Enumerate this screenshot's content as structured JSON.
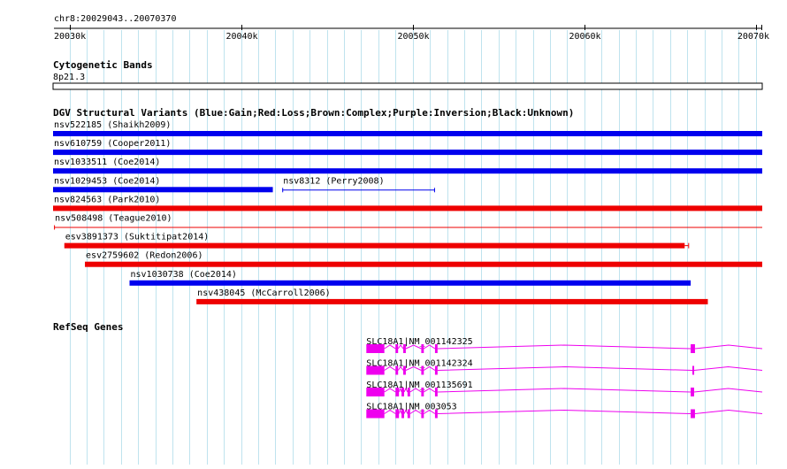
{
  "browser": {
    "location": "chr8:20029043..20070370",
    "view_start": 20029043,
    "view_end": 20070370,
    "ruler_ticks": [
      {
        "pos": 20030000,
        "label": "20030k"
      },
      {
        "pos": 20040000,
        "label": "20040k"
      },
      {
        "pos": 20050000,
        "label": "20050k"
      },
      {
        "pos": 20060000,
        "label": "20060k"
      },
      {
        "pos": 20070000,
        "label": "20070k"
      }
    ],
    "grid_step": 1000
  },
  "tracks": {
    "cytoband": {
      "title": "Cytogenetic Bands",
      "band_label": "8p21.3"
    },
    "dgv": {
      "title": "DGV Structural Variants (Blue:Gain;Red:Loss;Brown:Complex;Purple:Inversion;Black:Unknown)",
      "colors": {
        "gain": "#0000ee",
        "loss": "#ee0000"
      },
      "variants": [
        {
          "label": "nsv522185 (Shaikh2009)",
          "type": "gain",
          "start": 20029043,
          "end": 20070370,
          "row": 0,
          "style": "thick"
        },
        {
          "label": "nsv610759 (Cooper2011)",
          "type": "gain",
          "start": 20029043,
          "end": 20070370,
          "row": 1,
          "style": "thick"
        },
        {
          "label": "nsv1033511 (Coe2014)",
          "type": "gain",
          "start": 20029043,
          "end": 20070370,
          "row": 2,
          "style": "thick"
        },
        {
          "label": "nsv1029453 (Coe2014)",
          "type": "gain",
          "start": 20029043,
          "end": 20041850,
          "row": 3,
          "style": "thick"
        },
        {
          "label": "nsv8312 (Perry2008)",
          "type": "gain",
          "start": 20042400,
          "end": 20051300,
          "row": 3,
          "style": "thin"
        },
        {
          "label": "nsv824563 (Park2010)",
          "type": "loss",
          "start": 20029043,
          "end": 20070370,
          "row": 4,
          "style": "thick"
        },
        {
          "label": "nsv508498 (Teague2010)",
          "type": "loss",
          "start": 20029100,
          "end": 20070370,
          "row": 5,
          "style": "thin"
        },
        {
          "label": "esv3891373 (Suktitipat2014)",
          "type": "loss",
          "start": 20029700,
          "end": 20065850,
          "row": 6,
          "style": "thick_tail"
        },
        {
          "label": "esv2759602 (Redon2006)",
          "type": "loss",
          "start": 20030900,
          "end": 20070370,
          "row": 7,
          "style": "thick"
        },
        {
          "label": "nsv1030738 (Coe2014)",
          "type": "gain",
          "start": 20033500,
          "end": 20066200,
          "row": 8,
          "style": "thick"
        },
        {
          "label": "nsv438045 (McCarroll2006)",
          "type": "loss",
          "start": 20037400,
          "end": 20067200,
          "row": 9,
          "style": "thick"
        }
      ]
    },
    "refseq": {
      "title": "RefSeq Genes",
      "color": "#ee00ee",
      "transcripts": [
        {
          "label": "SLC18A1|NM_001142325",
          "start": 20047300,
          "end": 20070370,
          "exons": [
            [
              20047300,
              20048350
            ],
            [
              20049000,
              20049150
            ],
            [
              20049450,
              20049600
            ],
            [
              20050500,
              20050650
            ],
            [
              20051300,
              20051450
            ],
            [
              20066200,
              20066450
            ]
          ]
        },
        {
          "label": "SLC18A1|NM_001142324",
          "start": 20047300,
          "end": 20070370,
          "exons": [
            [
              20047300,
              20048350
            ],
            [
              20049000,
              20049150
            ],
            [
              20049450,
              20049600
            ],
            [
              20050500,
              20050650
            ],
            [
              20051300,
              20051450
            ],
            [
              20066300,
              20066400
            ]
          ]
        },
        {
          "label": "SLC18A1|NM_001135691",
          "start": 20047300,
          "end": 20070370,
          "exons": [
            [
              20047300,
              20048350
            ],
            [
              20049000,
              20049200
            ],
            [
              20049350,
              20049500
            ],
            [
              20049700,
              20049850
            ],
            [
              20050500,
              20050650
            ],
            [
              20051300,
              20051450
            ],
            [
              20066200,
              20066400
            ]
          ]
        },
        {
          "label": "SLC18A1|NM_003053",
          "start": 20047300,
          "end": 20070370,
          "exons": [
            [
              20047300,
              20048350
            ],
            [
              20049000,
              20049200
            ],
            [
              20049350,
              20049500
            ],
            [
              20049700,
              20049850
            ],
            [
              20050500,
              20050650
            ],
            [
              20051300,
              20051450
            ],
            [
              20066200,
              20066450
            ]
          ]
        }
      ]
    }
  }
}
